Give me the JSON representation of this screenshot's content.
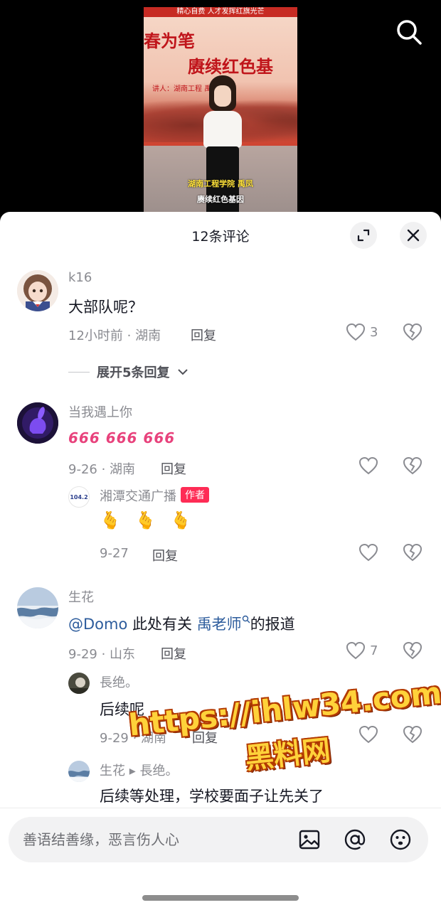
{
  "video": {
    "banner_text": "精心自费 人才发挥红旗光芒",
    "title_line1": "春为笔",
    "title_line2": "赓续红色基",
    "speaker_line": "讲人：湖南工程   禹凤",
    "subtitle1": "湖南工程学院 禹凤",
    "subtitle2": "赓续红色基因"
  },
  "header": {
    "title": "12条评论"
  },
  "comments": [
    {
      "username": "k16",
      "text": "大部队呢？",
      "meta": "12小时前 · 湖南",
      "reply_label": "回复",
      "likes": "3",
      "expand_label": "展开5条回复"
    },
    {
      "username": "当我遇上你",
      "text": "666 666 666",
      "meta": "9-26 · 湖南",
      "reply_label": "回复",
      "replies": [
        {
          "username": "湘潭交通广播",
          "badge": "作者",
          "avatar_text": "104.2",
          "text": "🫰 🫰 🫰",
          "meta": "9-27",
          "reply_label": "回复"
        }
      ]
    },
    {
      "username": "生花",
      "mention": "@Domo",
      "text_mid": " 此处有关 ",
      "link": "禹老师",
      "text_end": "的报道",
      "meta": "9-29 · 山东",
      "reply_label": "回复",
      "likes": "7",
      "replies": [
        {
          "username": "長绝。",
          "text": "后续呢",
          "meta": "9-29 · 湖南",
          "reply_label": "回复"
        },
        {
          "username": "生花 ▸ 長绝。",
          "text": "后续等处理，学校要面子让先关了"
        }
      ]
    }
  ],
  "input": {
    "placeholder": "善语结善缘，恶言伤人心"
  },
  "watermark": {
    "line1": "https://ihlw34.com",
    "line2": "黑料网"
  },
  "colors": {
    "accent": "#fe2c55",
    "link": "#2d5c9c",
    "muted": "#8a8b91"
  }
}
